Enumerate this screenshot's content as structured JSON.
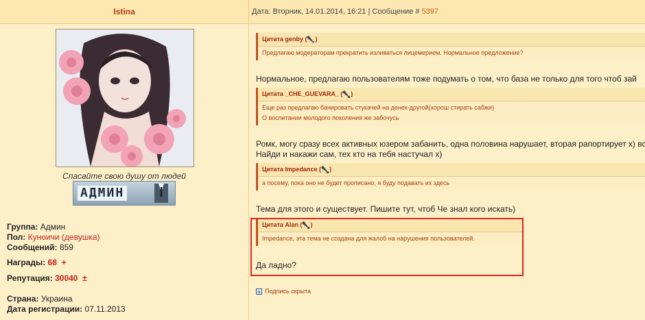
{
  "user": {
    "name": "Istina",
    "motto": "Спасайте свою душу от людей",
    "rank_badge": "АДМИН",
    "group_label": "Группа:",
    "group": "Админ",
    "gender_label": "Пол:",
    "gender": "Куноичи (девушка)",
    "messages_label": "Сообщений:",
    "messages": "859",
    "awards_label": "Награды:",
    "awards": "68",
    "awards_plus": "+",
    "reputation_label": "Репутация:",
    "reputation": "30040",
    "reputation_pm": "±",
    "country_label": "Страна:",
    "country": "Украина",
    "reg_label": "Дата регистрации:",
    "reg_date": "07.11.2013"
  },
  "post": {
    "date_prefix": "Дата: Вторник, 14.01.2014, 16:21 | Сообщение #",
    "number": "5397",
    "blocks": [
      {
        "title": "Цитата genby (",
        "body": [
          "Предлагаю модераторам прекратить изливаться лицемерием. Нормальное предложение?"
        ]
      },
      {
        "title": "Цитата _CHE_GUEVARA_ (",
        "body": [
          "Еще раз предлагаю банировать стукачей на денек-другой(хорош стирать сабжи)",
          "О воспитании молодого поколения же забочусь"
        ]
      },
      {
        "title": "Цитата Impedance (",
        "body": [
          "а посему, пока оно не будет прописано, я буду подавать их здесь"
        ]
      },
      {
        "title": "Цитата Alan (",
        "body": [
          "Impedance, эта тема не создана для жалоб на нарушения пользователей."
        ]
      }
    ],
    "texts": [
      "Нормальное, предлагаю пользователям тоже подумать о том, что база не только для того чтоб зай",
      "Ромк, могу сразу всех активных юзером забанить, одна половина нарушает, вторая рапортирует х) вс",
      "Найди и накажи сам, тех кто на тебя настучал х)",
      "Тема для этого и существует. Пишите тут, чтоб Че знал кого искать)",
      "Да ладно?"
    ],
    "quote_close": ")",
    "signature_hidden": "Подпись скрыта"
  }
}
